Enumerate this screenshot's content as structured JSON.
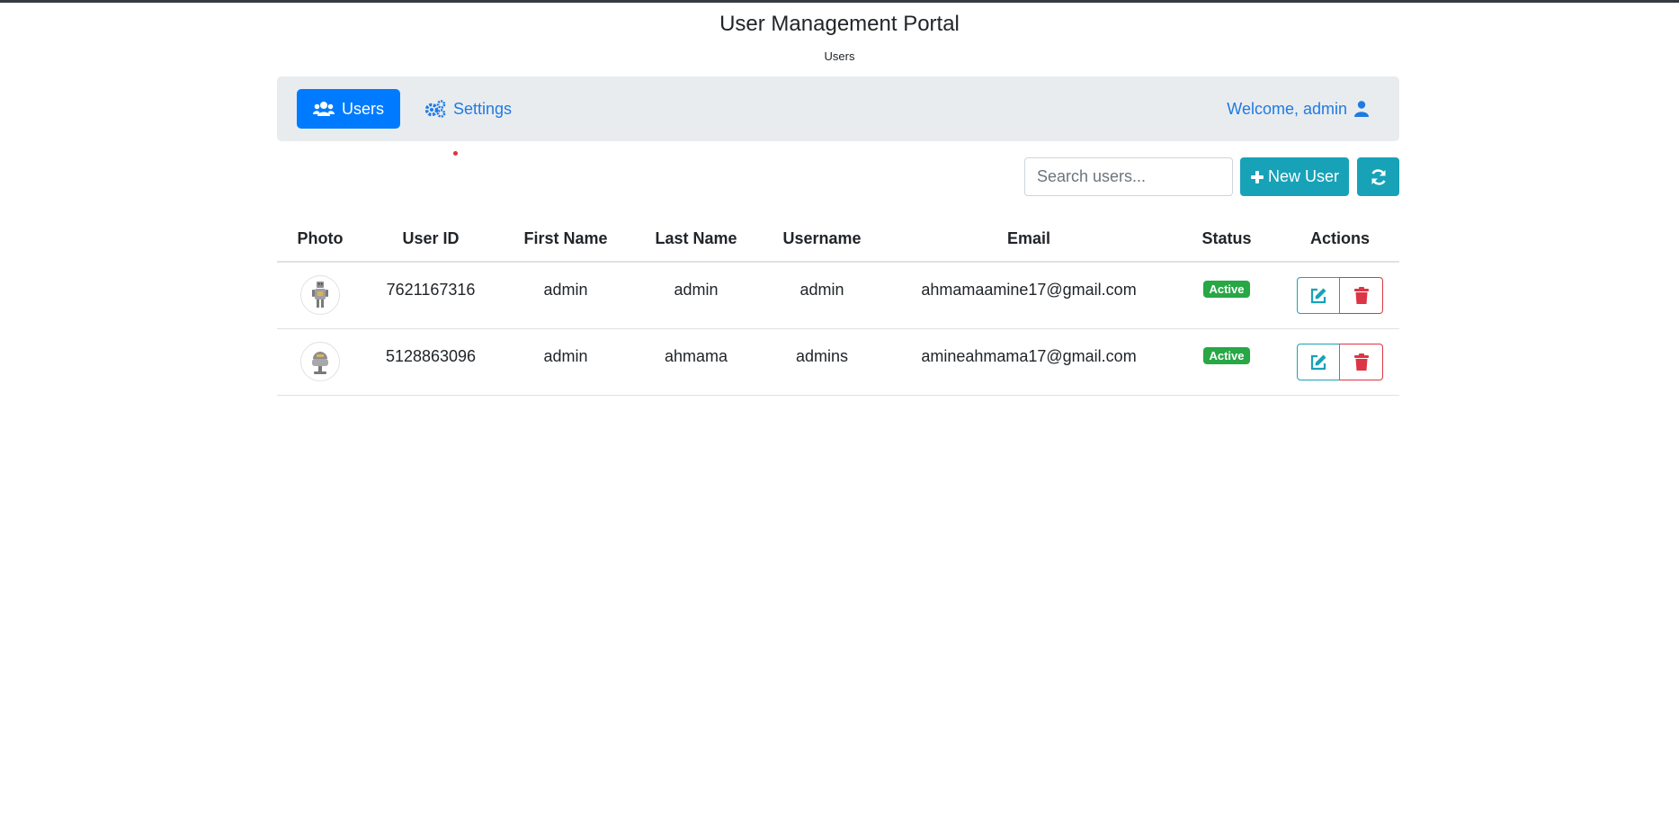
{
  "header": {
    "title": "User Management Portal",
    "subtitle": "Users"
  },
  "nav": {
    "users_label": "Users",
    "settings_label": "Settings",
    "welcome_label": "Welcome, admin",
    "users_icon": "users-icon",
    "settings_icon": "cogs-icon",
    "welcome_icon": "user-icon"
  },
  "toolbar": {
    "search_placeholder": "Search users...",
    "search_value": "",
    "new_user_label": "New User",
    "refresh_icon": "refresh-icon"
  },
  "table": {
    "columns": [
      "Photo",
      "User ID",
      "First Name",
      "Last Name",
      "Username",
      "Email",
      "Status",
      "Actions"
    ],
    "rows": [
      {
        "photo": "robot-avatar",
        "user_id": "7621167316",
        "first_name": "admin",
        "last_name": "admin",
        "username": "admin",
        "email": "ahmamaamine17@gmail.com",
        "status": "Active"
      },
      {
        "photo": "robot-avatar",
        "user_id": "5128863096",
        "first_name": "admin",
        "last_name": "ahmama",
        "username": "admins",
        "email": "amineahmama17@gmail.com",
        "status": "Active"
      }
    ]
  },
  "colors": {
    "primary": "#007bff",
    "info": "#17a2b8",
    "danger": "#dc3545",
    "success": "#28a745",
    "navbar_bg": "#e9ecef"
  }
}
